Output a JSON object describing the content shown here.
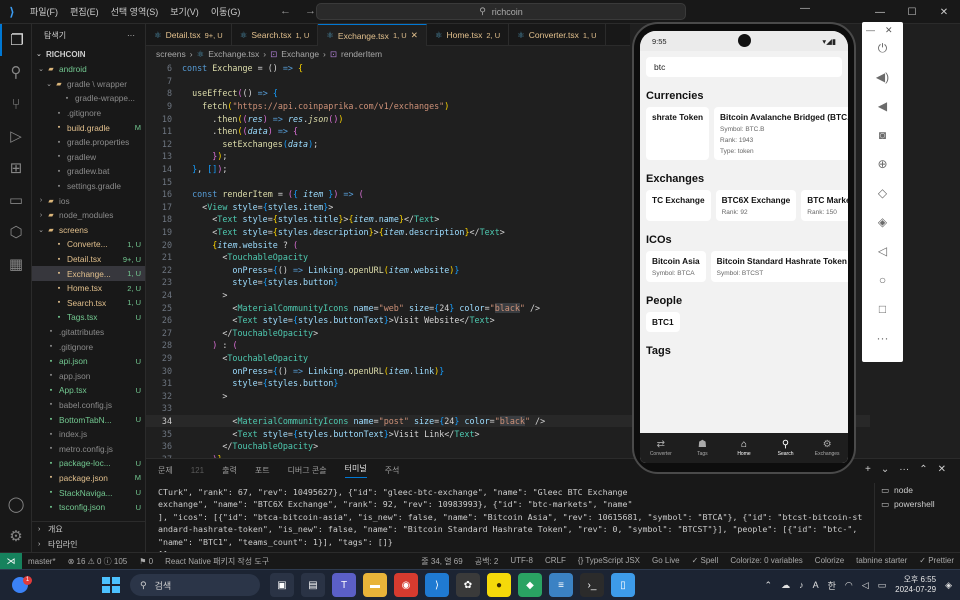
{
  "titlebar": {
    "menu": [
      "파일(F)",
      "편집(E)",
      "선택 영역(S)",
      "보기(V)",
      "이동(G)"
    ],
    "search": "richcoin"
  },
  "sidebar": {
    "header": "탐색기",
    "project": "RICHCOIN",
    "items": [
      {
        "label": "android",
        "badge": "",
        "type": "folder-open",
        "color": "c-green",
        "indent": 0
      },
      {
        "label": "gradle \\ wrapper",
        "badge": "",
        "type": "folder-open",
        "color": "c-gray",
        "indent": 1
      },
      {
        "label": "gradle-wrappe...",
        "badge": "",
        "type": "file",
        "color": "c-gray",
        "indent": 2
      },
      {
        "label": ".gitignore",
        "badge": "",
        "type": "file",
        "color": "c-gray",
        "indent": 1
      },
      {
        "label": "build.gradle",
        "badge": "M",
        "type": "file",
        "color": "c-mod",
        "indent": 1
      },
      {
        "label": "gradle.properties",
        "badge": "",
        "type": "file",
        "color": "c-gray",
        "indent": 1
      },
      {
        "label": "gradlew",
        "badge": "",
        "type": "file",
        "color": "c-gray",
        "indent": 1
      },
      {
        "label": "gradlew.bat",
        "badge": "",
        "type": "file",
        "color": "c-gray",
        "indent": 1
      },
      {
        "label": "settings.gradle",
        "badge": "",
        "type": "file",
        "color": "c-gray",
        "indent": 1
      },
      {
        "label": "ios",
        "badge": "",
        "type": "folder",
        "color": "c-gray",
        "indent": 0
      },
      {
        "label": "node_modules",
        "badge": "",
        "type": "folder",
        "color": "c-gray",
        "indent": 0
      },
      {
        "label": "screens",
        "badge": "",
        "type": "folder-open",
        "color": "c-orange",
        "indent": 0
      },
      {
        "label": "Converte...",
        "badge": "1, U",
        "type": "file",
        "color": "c-orange",
        "indent": 1
      },
      {
        "label": "Detail.tsx",
        "badge": "9+, U",
        "type": "file",
        "color": "c-orange",
        "indent": 1
      },
      {
        "label": "Exchange...",
        "badge": "1, U",
        "type": "file",
        "color": "c-orange",
        "indent": 1,
        "selected": true
      },
      {
        "label": "Home.tsx",
        "badge": "2, U",
        "type": "file",
        "color": "c-orange",
        "indent": 1
      },
      {
        "label": "Search.tsx",
        "badge": "1, U",
        "type": "file",
        "color": "c-orange",
        "indent": 1
      },
      {
        "label": "Tags.tsx",
        "badge": "U",
        "type": "file",
        "color": "c-green",
        "indent": 1
      },
      {
        "label": ".gitattributes",
        "badge": "",
        "type": "file",
        "color": "c-gray",
        "indent": 0
      },
      {
        "label": ".gitignore",
        "badge": "",
        "type": "file",
        "color": "c-gray",
        "indent": 0
      },
      {
        "label": "api.json",
        "badge": "U",
        "type": "file",
        "color": "c-green",
        "indent": 0
      },
      {
        "label": "app.json",
        "badge": "",
        "type": "file",
        "color": "c-gray",
        "indent": 0
      },
      {
        "label": "App.tsx",
        "badge": "U",
        "type": "file",
        "color": "c-green",
        "indent": 0
      },
      {
        "label": "babel.config.js",
        "badge": "",
        "type": "file",
        "color": "c-gray",
        "indent": 0
      },
      {
        "label": "BottomTabN...",
        "badge": "U",
        "type": "file",
        "color": "c-green",
        "indent": 0
      },
      {
        "label": "index.js",
        "badge": "",
        "type": "file",
        "color": "c-gray",
        "indent": 0
      },
      {
        "label": "metro.config.js",
        "badge": "",
        "type": "file",
        "color": "c-gray",
        "indent": 0
      },
      {
        "label": "package-loc...",
        "badge": "U",
        "type": "file",
        "color": "c-green",
        "indent": 0
      },
      {
        "label": "package.json",
        "badge": "M",
        "type": "file",
        "color": "c-mod",
        "indent": 0
      },
      {
        "label": "StackNaviga...",
        "badge": "U",
        "type": "file",
        "color": "c-green",
        "indent": 0
      },
      {
        "label": "tsconfig.json",
        "badge": "U",
        "type": "file",
        "color": "c-green",
        "indent": 0
      }
    ],
    "outline": [
      "개요",
      "타임라인"
    ]
  },
  "tabs": [
    {
      "label": "Detail.tsx",
      "mark": "9+, U",
      "active": false
    },
    {
      "label": "Search.tsx",
      "mark": "1, U",
      "active": false
    },
    {
      "label": "Exchange.tsx",
      "mark": "1, U",
      "active": true
    },
    {
      "label": "Home.tsx",
      "mark": "2, U",
      "active": false
    },
    {
      "label": "Converter.tsx",
      "mark": "1, U",
      "active": false
    }
  ],
  "breadcrumb": [
    "screens",
    "Exchange.tsx",
    "Exchange",
    "renderItem"
  ],
  "code": {
    "current_line": 34,
    "lines": [
      {
        "n": 6,
        "html": "<span class='kw'>const</span> <span class='fn'>Exchange</span> = () <span class='kw'>=&gt;</span> <span class='brk'>{</span>"
      },
      {
        "n": 7,
        "html": ""
      },
      {
        "n": 8,
        "html": "  <span class='fn'>useEffect</span><span class='brk2'>(</span>() <span class='kw'>=&gt;</span> <span class='brk3'>{</span>"
      },
      {
        "n": 9,
        "html": "    <span class='fn'>fetch</span><span class='brk'>(</span><span class='str'>\"https://api.coinpaprika.com/v1/exchanges\"</span><span class='brk'>)</span>"
      },
      {
        "n": 10,
        "html": "      .<span class='fn'>then</span><span class='brk'>(</span><span class='brk2'>(</span><span class='var ital'>res</span><span class='brk2'>)</span> <span class='kw'>=&gt;</span> <span class='var ital'>res</span>.<span class='fn ital'>json</span><span class='brk2'>()</span><span class='brk'>)</span>"
      },
      {
        "n": 11,
        "html": "      .<span class='fn'>then</span><span class='brk'>(</span><span class='brk2'>(</span><span class='var ital'>data</span><span class='brk2'>)</span> <span class='kw'>=&gt;</span> <span class='brk2'>{</span>"
      },
      {
        "n": 12,
        "html": "        <span class='fn'>setExchanges</span><span class='brk3'>(</span><span class='var ital'>data</span><span class='brk3'>)</span>;"
      },
      {
        "n": 13,
        "html": "      <span class='brk2'>}</span><span class='brk'>)</span>;"
      },
      {
        "n": 14,
        "html": "  <span class='brk3'>}</span>, <span class='brk3'>[]</span><span class='brk2'>)</span>;"
      },
      {
        "n": 15,
        "html": ""
      },
      {
        "n": 16,
        "html": "  <span class='kw'>const</span> <span class='fn'>renderItem</span> = <span class='brk2'>(</span><span class='brk3'>{</span> <span class='var ital'>item</span> <span class='brk3'>}</span><span class='brk2'>)</span> <span class='kw'>=&gt;</span> <span class='brk2'>(</span>"
      },
      {
        "n": 17,
        "html": "    &lt;<span class='tag'>View</span> <span class='attr'>style</span>=<span class='brk3'>{</span><span class='var'>styles</span>.<span class='var'>item</span><span class='brk3'>}</span>&gt;"
      },
      {
        "n": 18,
        "html": "      &lt;<span class='tag'>Text</span> <span class='attr'>style</span>=<span class='brk'>{</span><span class='var'>styles</span>.<span class='var'>title</span><span class='brk'>}</span>&gt;<span class='brk'>{</span><span class='var ital'>item</span>.<span class='var'>name</span><span class='brk'>}</span>&lt;/<span class='tag'>Text</span>&gt;"
      },
      {
        "n": 19,
        "html": "      &lt;<span class='tag'>Text</span> <span class='attr'>style</span>=<span class='brk'>{</span><span class='var'>styles</span>.<span class='var'>description</span><span class='brk'>}</span>&gt;<span class='brk'>{</span><span class='var ital'>item</span>.<span class='var'>description</span><span class='brk'>}</span>&lt;/<span class='tag'>Text</span>&gt;"
      },
      {
        "n": 20,
        "html": "      <span class='brk'>{</span><span class='var ital'>item</span>.<span class='var'>website</span> ? <span class='brk2'>(</span>"
      },
      {
        "n": 21,
        "html": "        &lt;<span class='tag'>TouchableOpacity</span>"
      },
      {
        "n": 22,
        "html": "          <span class='attr'>onPress</span>=<span class='brk3'>{</span>() <span class='kw'>=&gt;</span> <span class='var'>Linking</span>.<span class='fn'>openURL</span><span class='brk'>(</span><span class='var ital'>item</span>.<span class='var'>website</span><span class='brk'>)</span><span class='brk3'>}</span>"
      },
      {
        "n": 23,
        "html": "          <span class='attr'>style</span>=<span class='brk3'>{</span><span class='var'>styles</span>.<span class='var'>button</span><span class='brk3'>}</span>"
      },
      {
        "n": 24,
        "html": "        &gt;"
      },
      {
        "n": 25,
        "html": "          &lt;<span class='tag'>MaterialCommunityIcons</span> <span class='attr'>name</span>=<span class='str'>\"web\"</span> <span class='attr'>size</span>=<span class='brk3'>{</span><span class='ct'>24</span><span class='brk3'>}</span> <span class='attr'>color</span>=<span class='str'>\"<span class='hl'>black</span>\"</span> /&gt;"
      },
      {
        "n": 26,
        "html": "          &lt;<span class='tag'>Text</span> <span class='attr'>style</span>=<span class='brk3'>{</span><span class='var'>styles</span>.<span class='var'>buttonText</span><span class='brk3'>}</span>&gt;Visit Website&lt;/<span class='tag'>Text</span>&gt;"
      },
      {
        "n": 27,
        "html": "        &lt;/<span class='tag'>TouchableOpacity</span>&gt;"
      },
      {
        "n": 28,
        "html": "      <span class='brk2'>)</span> : <span class='brk2'>(</span>"
      },
      {
        "n": 29,
        "html": "        &lt;<span class='tag'>TouchableOpacity</span>"
      },
      {
        "n": 30,
        "html": "          <span class='attr'>onPress</span>=<span class='brk3'>{</span>() <span class='kw'>=&gt;</span> <span class='var'>Linking</span>.<span class='fn'>openURL</span><span class='brk'>(</span><span class='var ital'>item</span>.<span class='var'>link</span><span class='brk'>)</span><span class='brk3'>}</span>"
      },
      {
        "n": 31,
        "html": "          <span class='attr'>style</span>=<span class='brk3'>{</span><span class='var'>styles</span>.<span class='var'>button</span><span class='brk3'>}</span>"
      },
      {
        "n": 32,
        "html": "        &gt;"
      },
      {
        "n": 33,
        "html": ""
      },
      {
        "n": 34,
        "html": "          &lt;<span class='tag'>MaterialCommunityIcons</span> <span class='attr'>name</span>=<span class='str'>\"post\"</span> <span class='attr'>size</span>=<span class='brk3'>{</span><span class='ct'>24</span><span class='brk3'>}</span> <span class='attr'>color</span>=<span class='str'>\"<span class='hl'>black</span>\"</span> /&gt;"
      },
      {
        "n": 35,
        "html": "          &lt;<span class='tag'>Text</span> <span class='attr'>style</span>=<span class='brk3'>{</span><span class='var'>styles</span>.<span class='var'>buttonText</span><span class='brk3'>}</span>&gt;Visit Link&lt;/<span class='tag'>Text</span>&gt;"
      },
      {
        "n": 36,
        "html": "        &lt;/<span class='tag'>TouchableOpacity</span>&gt;"
      },
      {
        "n": 37,
        "html": "      <span class='brk2'>)</span><span class='brk'>}</span>"
      },
      {
        "n": 38,
        "html": "    &lt;/<span class='tag'>View</span>&gt;"
      }
    ]
  },
  "panel": {
    "tabs": [
      {
        "label": "문제",
        "active": false
      },
      {
        "label": "121",
        "active": false,
        "dim": true
      },
      {
        "label": "출력",
        "active": false
      },
      {
        "label": "포트",
        "active": false
      },
      {
        "label": "디버그 콘솔",
        "active": false
      },
      {
        "label": "터미널",
        "active": true
      },
      {
        "label": "주석",
        "active": false
      }
    ],
    "terminal_lines": [
      "CTurk\", \"rank\": 67, \"rev\": 10495627}, {\"id\": \"gleec-btc-exchange\", \"name\": \"Gleec BTC Exchange",
      "exchange\", \"name\": \"BTC6X Exchange\", \"rank\": 92, \"rev\": 10983993}, {\"id\": \"btc-markets\", \"name\"",
      "], \"icos\": [{\"id\": \"btca-bitcoin-asia\", \"is_new\": false, \"name\": \"Bitcoin Asia\", \"rev\": 10615681, \"symbol\": \"BTCA\"}, {\"id\": \"btcst-bitcoin-st",
      "andard-hashrate-token\", \"is_new\": false, \"name\": \"Bitcoin Standard Hashrate Token\", \"rev\": 0, \"symbol\": \"BTCST\"}], \"people\": [{\"id\": \"btc-\",",
      "\"name\": \"BTC1\", \"teams_count\": 1}], \"tags\": []}",
      "[]"
    ],
    "terminals": [
      {
        "label": "node",
        "selected": false
      },
      {
        "label": "powershell",
        "selected": false
      }
    ]
  },
  "statusbar": {
    "left": [
      "master*",
      "⊗ 16 ⚠ 0 ⓘ 105",
      "⚑ 0",
      "React Native 패키지 작성 도구"
    ],
    "right": [
      "줄 34, 열 69",
      "공백: 2",
      "UTF-8",
      "CRLF",
      "{} TypeScript JSX",
      "Go Live",
      "✓ Spell",
      "Colorize: 0 variables",
      "Colorize",
      "tabnine starter",
      "✓ Prettier"
    ]
  },
  "taskbar": {
    "badge": "1",
    "search": "검색",
    "time": "오후 6:55",
    "date": "2024-07-29",
    "ime": "한",
    "lang": "A"
  },
  "phone": {
    "time": "9:55",
    "search_value": "btc",
    "sections": [
      {
        "title": "Currencies",
        "cards": [
          {
            "name": "shrate Token",
            "lines": []
          },
          {
            "name": "Bitcoin Avalanche Bridged (BTC.b)",
            "lines": [
              "Symbol: BTC.B",
              "Rank: 1943",
              "Type: token"
            ]
          }
        ]
      },
      {
        "title": "Exchanges",
        "cards": [
          {
            "name": "TC Exchange",
            "lines": []
          },
          {
            "name": "BTC6X Exchange",
            "lines": [
              "Rank: 92"
            ]
          },
          {
            "name": "BTC Markets",
            "lines": [
              "Rank: 150"
            ]
          }
        ]
      },
      {
        "title": "ICOs",
        "cards": [
          {
            "name": "Bitcoin Asia",
            "lines": [
              "Symbol: BTCA"
            ]
          },
          {
            "name": "Bitcoin Standard Hashrate Token",
            "lines": [
              "Symbol: BTCST"
            ]
          }
        ]
      },
      {
        "title": "People",
        "cards": [
          {
            "name": "BTC1",
            "lines": []
          }
        ]
      },
      {
        "title": "Tags",
        "cards": []
      }
    ],
    "nav": [
      {
        "label": "Converter",
        "icon": "⇄",
        "active": false
      },
      {
        "label": "Tags",
        "icon": "☗",
        "active": false
      },
      {
        "label": "Home",
        "icon": "⌂",
        "active": true
      },
      {
        "label": "Search",
        "icon": "⚲",
        "active": true
      },
      {
        "label": "Exchanges",
        "icon": "⚙",
        "active": false
      }
    ]
  }
}
